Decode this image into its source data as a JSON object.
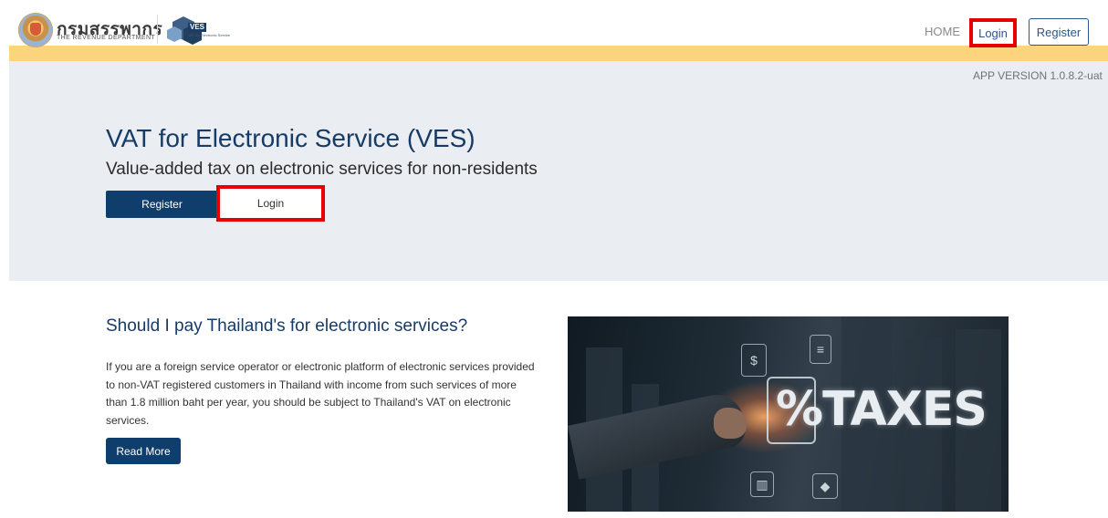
{
  "header": {
    "brand_thai": "กรมสรรพากร",
    "brand_en": "THE REVENUE DEPARTMENT",
    "ves_badge": "VES",
    "ves_sub": "VAT for Electronic Service",
    "nav": {
      "home": "HOME",
      "login": "Login",
      "register": "Register"
    }
  },
  "app_version": "APP VERSION 1.0.8.2-uat",
  "hero": {
    "title": "VAT for Electronic Service (VES)",
    "subtitle": "Value-added tax on electronic services for non-residents",
    "register_label": "Register",
    "login_label": "Login"
  },
  "info": {
    "title": "Should I pay Thailand's for electronic services?",
    "body": "If you are a foreign service operator or electronic platform of electronic services provided to non-VAT registered customers in Thailand with income from such services of more than 1.8 million baht per year, you should be subject to Thailand's VAT on electronic services.",
    "read_more": "Read More",
    "image_text": "TAXES",
    "image_percent": "%"
  },
  "colors": {
    "primary": "#0f3e6d",
    "accent_bar": "#fbd47d",
    "highlight": "#e60000",
    "hero_bg": "#eaedf1"
  },
  "icons": {
    "brand": "revenue-department-emblem",
    "ves": "ves-logo",
    "image_icons": [
      "dollar-icon",
      "chart-icon",
      "document-icon"
    ]
  }
}
